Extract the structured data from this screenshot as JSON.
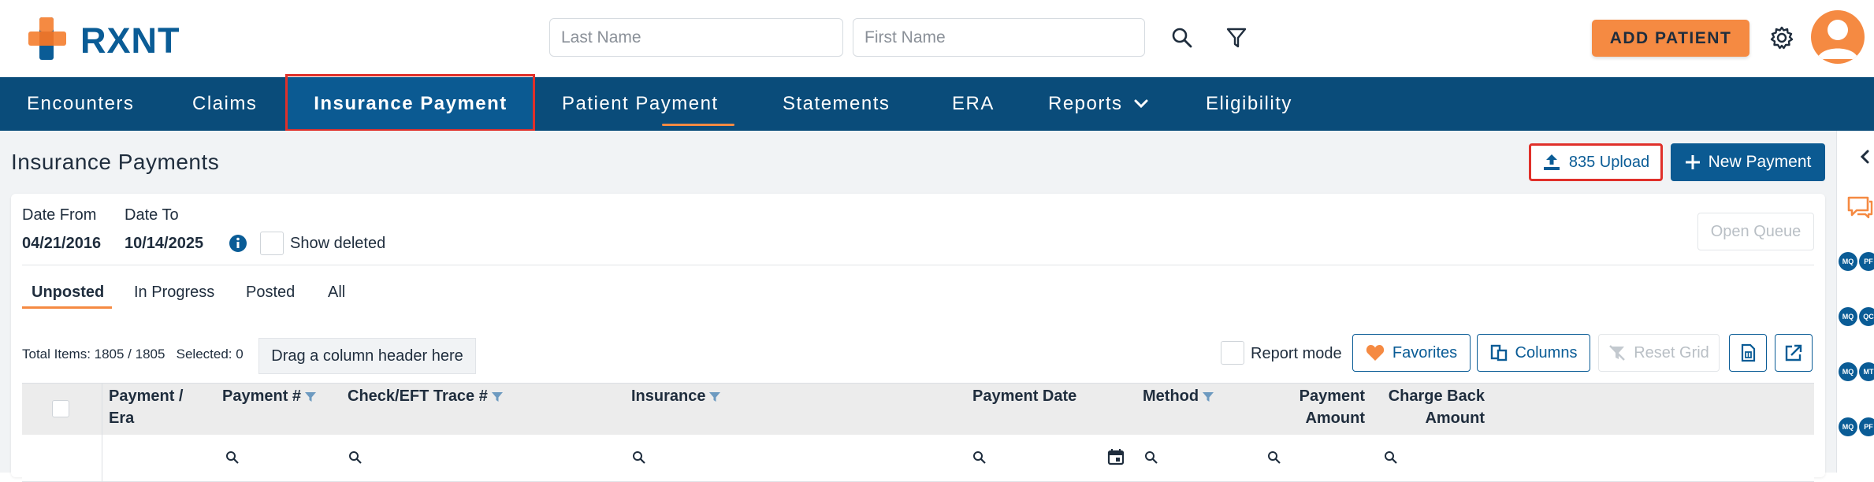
{
  "brand": {
    "name": "RXNT",
    "primary": "#0a4c7a",
    "accent": "#f58a42"
  },
  "search": {
    "last_name_placeholder": "Last Name",
    "first_name_placeholder": "First Name"
  },
  "header": {
    "add_patient_label": "ADD PATIENT"
  },
  "nav": {
    "items": [
      {
        "label": "Encounters"
      },
      {
        "label": "Claims"
      },
      {
        "label": "Insurance Payment",
        "active": true
      },
      {
        "label": "Patient Payment"
      },
      {
        "label": "Statements"
      },
      {
        "label": "ERA"
      },
      {
        "label": "Reports",
        "has_dropdown": true
      },
      {
        "label": "Eligibility"
      }
    ]
  },
  "page": {
    "title": "Insurance Payments",
    "upload_label": "835 Upload",
    "new_payment_label": "New Payment"
  },
  "filters": {
    "date_from_label": "Date From",
    "date_from_value": "04/21/2016",
    "date_to_label": "Date To",
    "date_to_value": "10/14/2025",
    "show_deleted_label": "Show deleted",
    "open_queue_label": "Open Queue"
  },
  "tabs": [
    {
      "label": "Unposted",
      "active": true
    },
    {
      "label": "In Progress"
    },
    {
      "label": "Posted"
    },
    {
      "label": "All"
    }
  ],
  "grid": {
    "total_items": "Total Items: 1805 / 1805",
    "selected": "Selected: 0",
    "drag_hint": "Drag a column header here",
    "report_mode_label": "Report mode",
    "favorites_label": "Favorites",
    "columns_label": "Columns",
    "reset_grid_label": "Reset Grid",
    "columns": [
      {
        "line1": "Payment /",
        "line2": "Era",
        "filterable": false
      },
      {
        "line1": "Payment #",
        "line2": "",
        "filterable": true
      },
      {
        "line1": "Check/EFT Trace #",
        "line2": "",
        "filterable": true
      },
      {
        "line1": "Insurance",
        "line2": "",
        "filterable": true
      },
      {
        "line1": "Payment Date",
        "line2": "",
        "filterable": false
      },
      {
        "line1": "Method",
        "line2": "",
        "filterable": true
      },
      {
        "line1": "Payment",
        "line2": "Amount",
        "filterable": false
      },
      {
        "line1": "Charge Back",
        "line2": "Amount",
        "filterable": false
      }
    ]
  },
  "rail": {
    "badges": [
      "MQ",
      "PF",
      "MQ",
      "QC",
      "MQ",
      "MT",
      "MQ",
      "PF"
    ]
  }
}
